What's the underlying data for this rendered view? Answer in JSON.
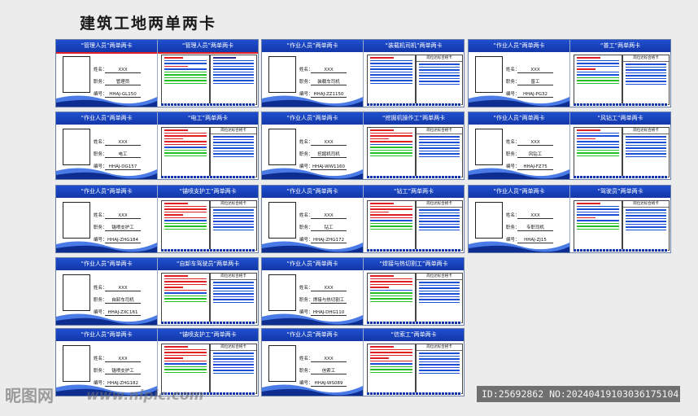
{
  "title": "建筑工地两单两卡",
  "watermark": {
    "logo": "昵图网",
    "url": "www.nipic.com",
    "id": "ID:25692862 NO:20240419103036175104"
  },
  "labels": {
    "name": "姓名：",
    "job": "职务：",
    "number": "编号：",
    "duty_card": "岗位达标合格卡"
  },
  "cards": [
    {
      "front_title": "“管理人员”两单两卡",
      "back_title": "“管理人员”两单两卡",
      "name": "XXX",
      "job": "管理员",
      "number": "HHAJ-GL150"
    },
    {
      "front_title": "“作业人员”两单两卡",
      "back_title": "“装载机司机”两单两卡",
      "name": "XXX",
      "job": "装载车司机",
      "number": "HHAJ-ZZ1150"
    },
    {
      "front_title": "“作业人员”两单两卡",
      "back_title": "“普工”两单两卡",
      "name": "XXX",
      "job": "普工",
      "number": "HHAJ-PG32"
    },
    {
      "front_title": "“作业人员”两单两卡",
      "back_title": "“电工”两单两卡",
      "name": "XXX",
      "job": "电工",
      "number": "HHAJ-DG157"
    },
    {
      "front_title": "“作业人员”两单两卡",
      "back_title": "“挖掘机操作工”两单两卡",
      "name": "XXX",
      "job": "挖掘机司机",
      "number": "HHAJ-WW1160"
    },
    {
      "front_title": "“作业人员”两单两卡",
      "back_title": "“风钻工”两单两卡",
      "name": "XXX",
      "job": "风钻工",
      "number": "HHAJ-FZ75"
    },
    {
      "front_title": "“作业人员”两单两卡",
      "back_title": "“锚喷支护工”两单两卡",
      "name": "XXX",
      "job": "锚喷支护工",
      "number": "HHAJ-ZHG184"
    },
    {
      "front_title": "“作业人员”两单两卡",
      "back_title": "“钻工”两单两卡",
      "name": "XXX",
      "job": "钻工",
      "number": "HHAJ-ZHG172"
    },
    {
      "front_title": "“作业人员”两单两卡",
      "back_title": "“驾驶员”两单两卡",
      "name": "XXX",
      "job": "专职司机",
      "number": "HHAJ-ZJ15"
    },
    {
      "front_title": "“作业人员”两单两卡",
      "back_title": "“自卸车驾驶员”两单两卡",
      "name": "XXX",
      "job": "自卸车司机",
      "number": "HHAJ-ZXC161"
    },
    {
      "front_title": "“作业人员”两单两卡",
      "back_title": "“焊接与热切割工”两单两卡",
      "name": "XXX",
      "job": "焊接与热切割工",
      "number": "HHAJ-DHG110"
    },
    {
      "front_title": "“作业人员”两单两卡",
      "back_title": "“锚喷支护工”两单两卡",
      "name": "XXX",
      "job": "锚喷支护工",
      "number": "HHAJ-ZHG182"
    },
    {
      "front_title": "“作业人员”两单两卡",
      "back_title": "“信索工”两单两卡",
      "name": "XXX",
      "job": "信索工",
      "number": "HHAJ-WS089"
    }
  ]
}
